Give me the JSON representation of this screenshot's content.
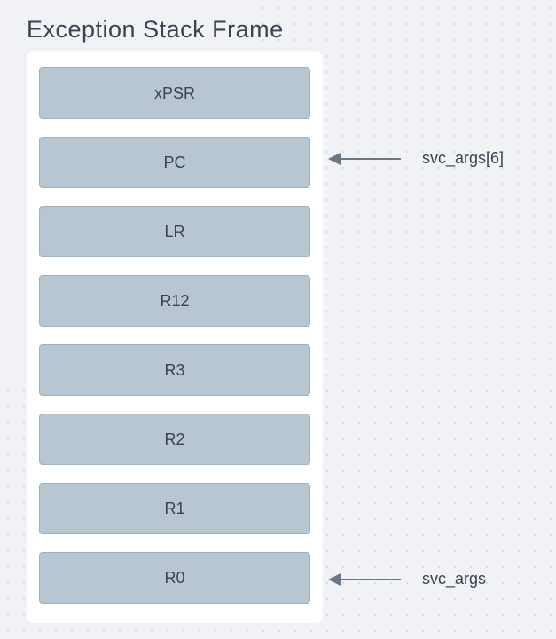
{
  "title": "Exception Stack Frame",
  "registers": [
    {
      "label": "xPSR"
    },
    {
      "label": "PC"
    },
    {
      "label": "LR"
    },
    {
      "label": "R12"
    },
    {
      "label": "R3"
    },
    {
      "label": "R2"
    },
    {
      "label": "R1"
    },
    {
      "label": "R0"
    }
  ],
  "arrows": [
    {
      "target_index": 1,
      "label": "svc_args[6]"
    },
    {
      "target_index": 7,
      "label": "svc_args"
    }
  ]
}
